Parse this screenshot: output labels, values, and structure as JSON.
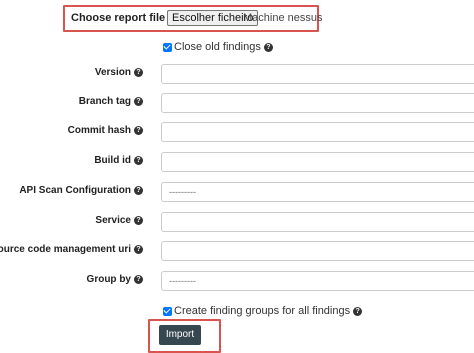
{
  "report_file": {
    "label": "Choose report file",
    "button_label": "Escolher ficheiro",
    "file_name": "Machine nessus"
  },
  "close_old_findings": {
    "label": "Close old findings",
    "checked": true
  },
  "fields": [
    {
      "label": "Version",
      "value": ""
    },
    {
      "label": "Branch tag",
      "value": ""
    },
    {
      "label": "Commit hash",
      "value": ""
    },
    {
      "label": "Build id",
      "value": ""
    },
    {
      "label": "API Scan Configuration",
      "value": "---------"
    },
    {
      "label": "Service",
      "value": ""
    },
    {
      "label": "Source code management uri",
      "value": ""
    },
    {
      "label": "Group by",
      "value": "---------"
    }
  ],
  "create_finding_groups": {
    "label": "Create finding groups for all findings",
    "checked": true
  },
  "import_button": {
    "label": "Import"
  },
  "help_icon_glyph": "?",
  "highlight_color": "#d9534f",
  "button_color": "#37474f"
}
